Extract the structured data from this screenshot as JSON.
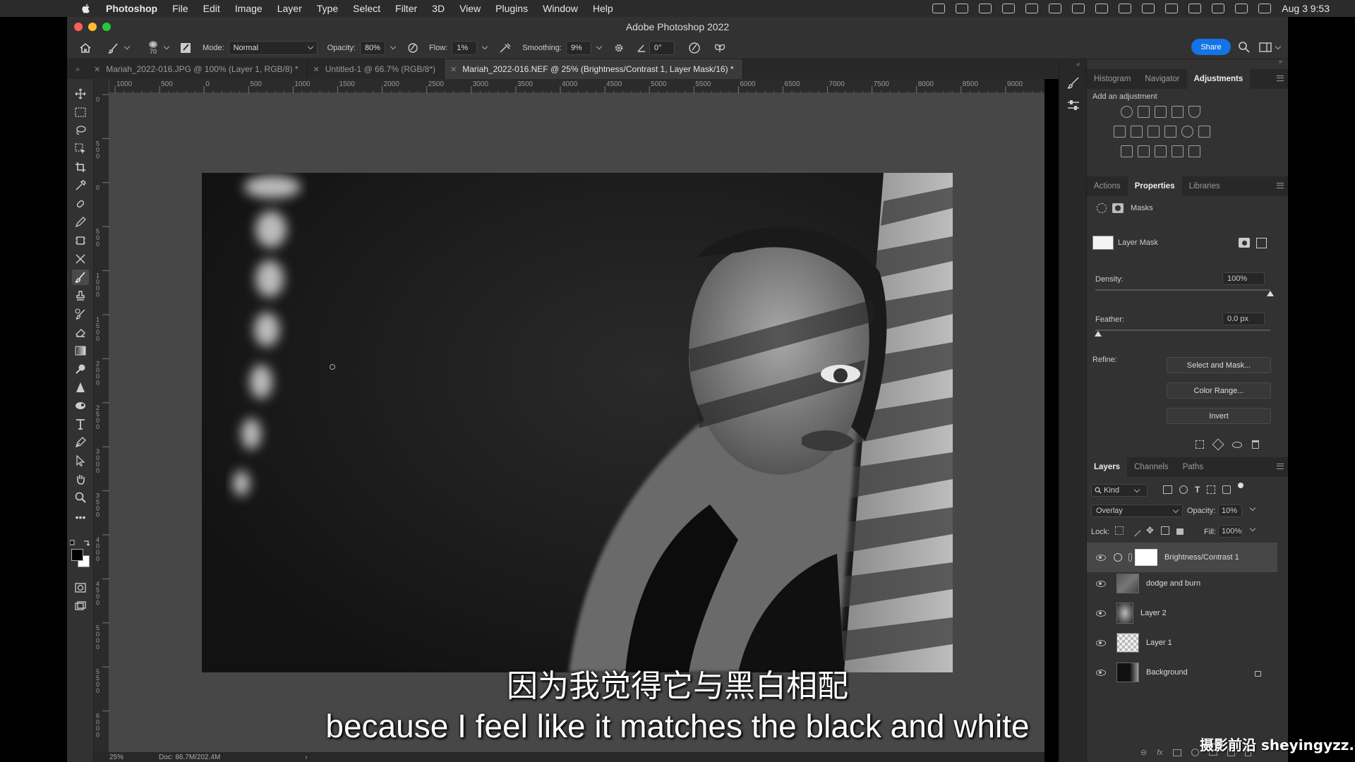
{
  "menubar": {
    "app_name": "Photoshop",
    "items": [
      "File",
      "Edit",
      "Image",
      "Layer",
      "Type",
      "Select",
      "Filter",
      "3D",
      "View",
      "Plugins",
      "Window",
      "Help"
    ],
    "datetime": "Aug 3  9:53"
  },
  "window": {
    "title": "Adobe Photoshop 2022"
  },
  "options": {
    "brush_size": "70",
    "mode_label": "Mode:",
    "mode_value": "Normal",
    "opacity_label": "Opacity:",
    "opacity_value": "80%",
    "flow_label": "Flow:",
    "flow_value": "1%",
    "smoothing_label": "Smoothing:",
    "smoothing_value": "9%",
    "angle_value": "0°",
    "share_label": "Share"
  },
  "tabs": [
    {
      "label": "Mariah_2022-016.JPG @ 100% (Layer 1, RGB/8) *",
      "active": false
    },
    {
      "label": "Untitled-1 @ 66.7% (RGB/8*)",
      "active": false
    },
    {
      "label": "Mariah_2022-016.NEF @ 25% (Brightness/Contrast 1, Layer Mask/16) *",
      "active": true
    }
  ],
  "ruler_top_ticks": [
    "1000",
    "500",
    "0",
    "500",
    "1000",
    "1500",
    "2000",
    "2500",
    "3000",
    "3500",
    "4000",
    "4500",
    "5000",
    "5500",
    "6000",
    "6500",
    "7000",
    "7500",
    "8000",
    "8500",
    "9000"
  ],
  "ruler_left_ticks": [
    "0",
    "5 0 0",
    "0",
    "5 0 0",
    "1 0 0 0",
    "1 5 0 0",
    "2 0 0 0",
    "2 5 0 0",
    "3 0 0 0",
    "3 5 0 0",
    "4 0 0 0",
    "4 5 0 0",
    "5 0 0 0",
    "5 5 0 0",
    "6 0 0 0"
  ],
  "statusbar": {
    "zoom": "25%",
    "doc": "Doc: 86.7M/202.4M"
  },
  "adjustments_panel": {
    "tabs": [
      "Histogram",
      "Navigator",
      "Adjustments"
    ],
    "active_tab": "Adjustments",
    "heading": "Add an adjustment"
  },
  "properties_panel": {
    "tabs": [
      "Actions",
      "Properties",
      "Libraries"
    ],
    "active_tab": "Properties",
    "section": "Masks",
    "mask_name": "Layer Mask",
    "density_label": "Density:",
    "density_value": "100%",
    "density_level": 1.0,
    "feather_label": "Feather:",
    "feather_value": "0.0 px",
    "feather_level": 0.0,
    "refine_label": "Refine:",
    "buttons": [
      "Select and Mask...",
      "Color Range...",
      "Invert"
    ]
  },
  "layers_panel": {
    "tabs": [
      "Layers",
      "Channels",
      "Paths"
    ],
    "active_tab": "Layers",
    "filter_kind": "Kind",
    "blend_mode": "Overlay",
    "opacity_label": "Opacity:",
    "opacity_value": "10%",
    "lock_label": "Lock:",
    "fill_label": "Fill:",
    "fill_value": "100%",
    "layers": [
      {
        "name": "Brightness/Contrast 1",
        "selected": true
      },
      {
        "name": "dodge and burn",
        "selected": false
      },
      {
        "name": "Layer 2",
        "selected": false
      },
      {
        "name": "Layer 1",
        "selected": false
      },
      {
        "name": "Background",
        "selected": false,
        "locked": true
      }
    ]
  },
  "subtitles": {
    "chinese": "因为我觉得它与黑白相配",
    "english": "because I feel like it matches the black and white"
  },
  "watermark": "摄影前沿 sheyingyzz.com",
  "colors": {
    "accent": "#1473e6",
    "close": "#ff5f57",
    "minimize": "#febc2e",
    "zoom": "#28c840"
  }
}
